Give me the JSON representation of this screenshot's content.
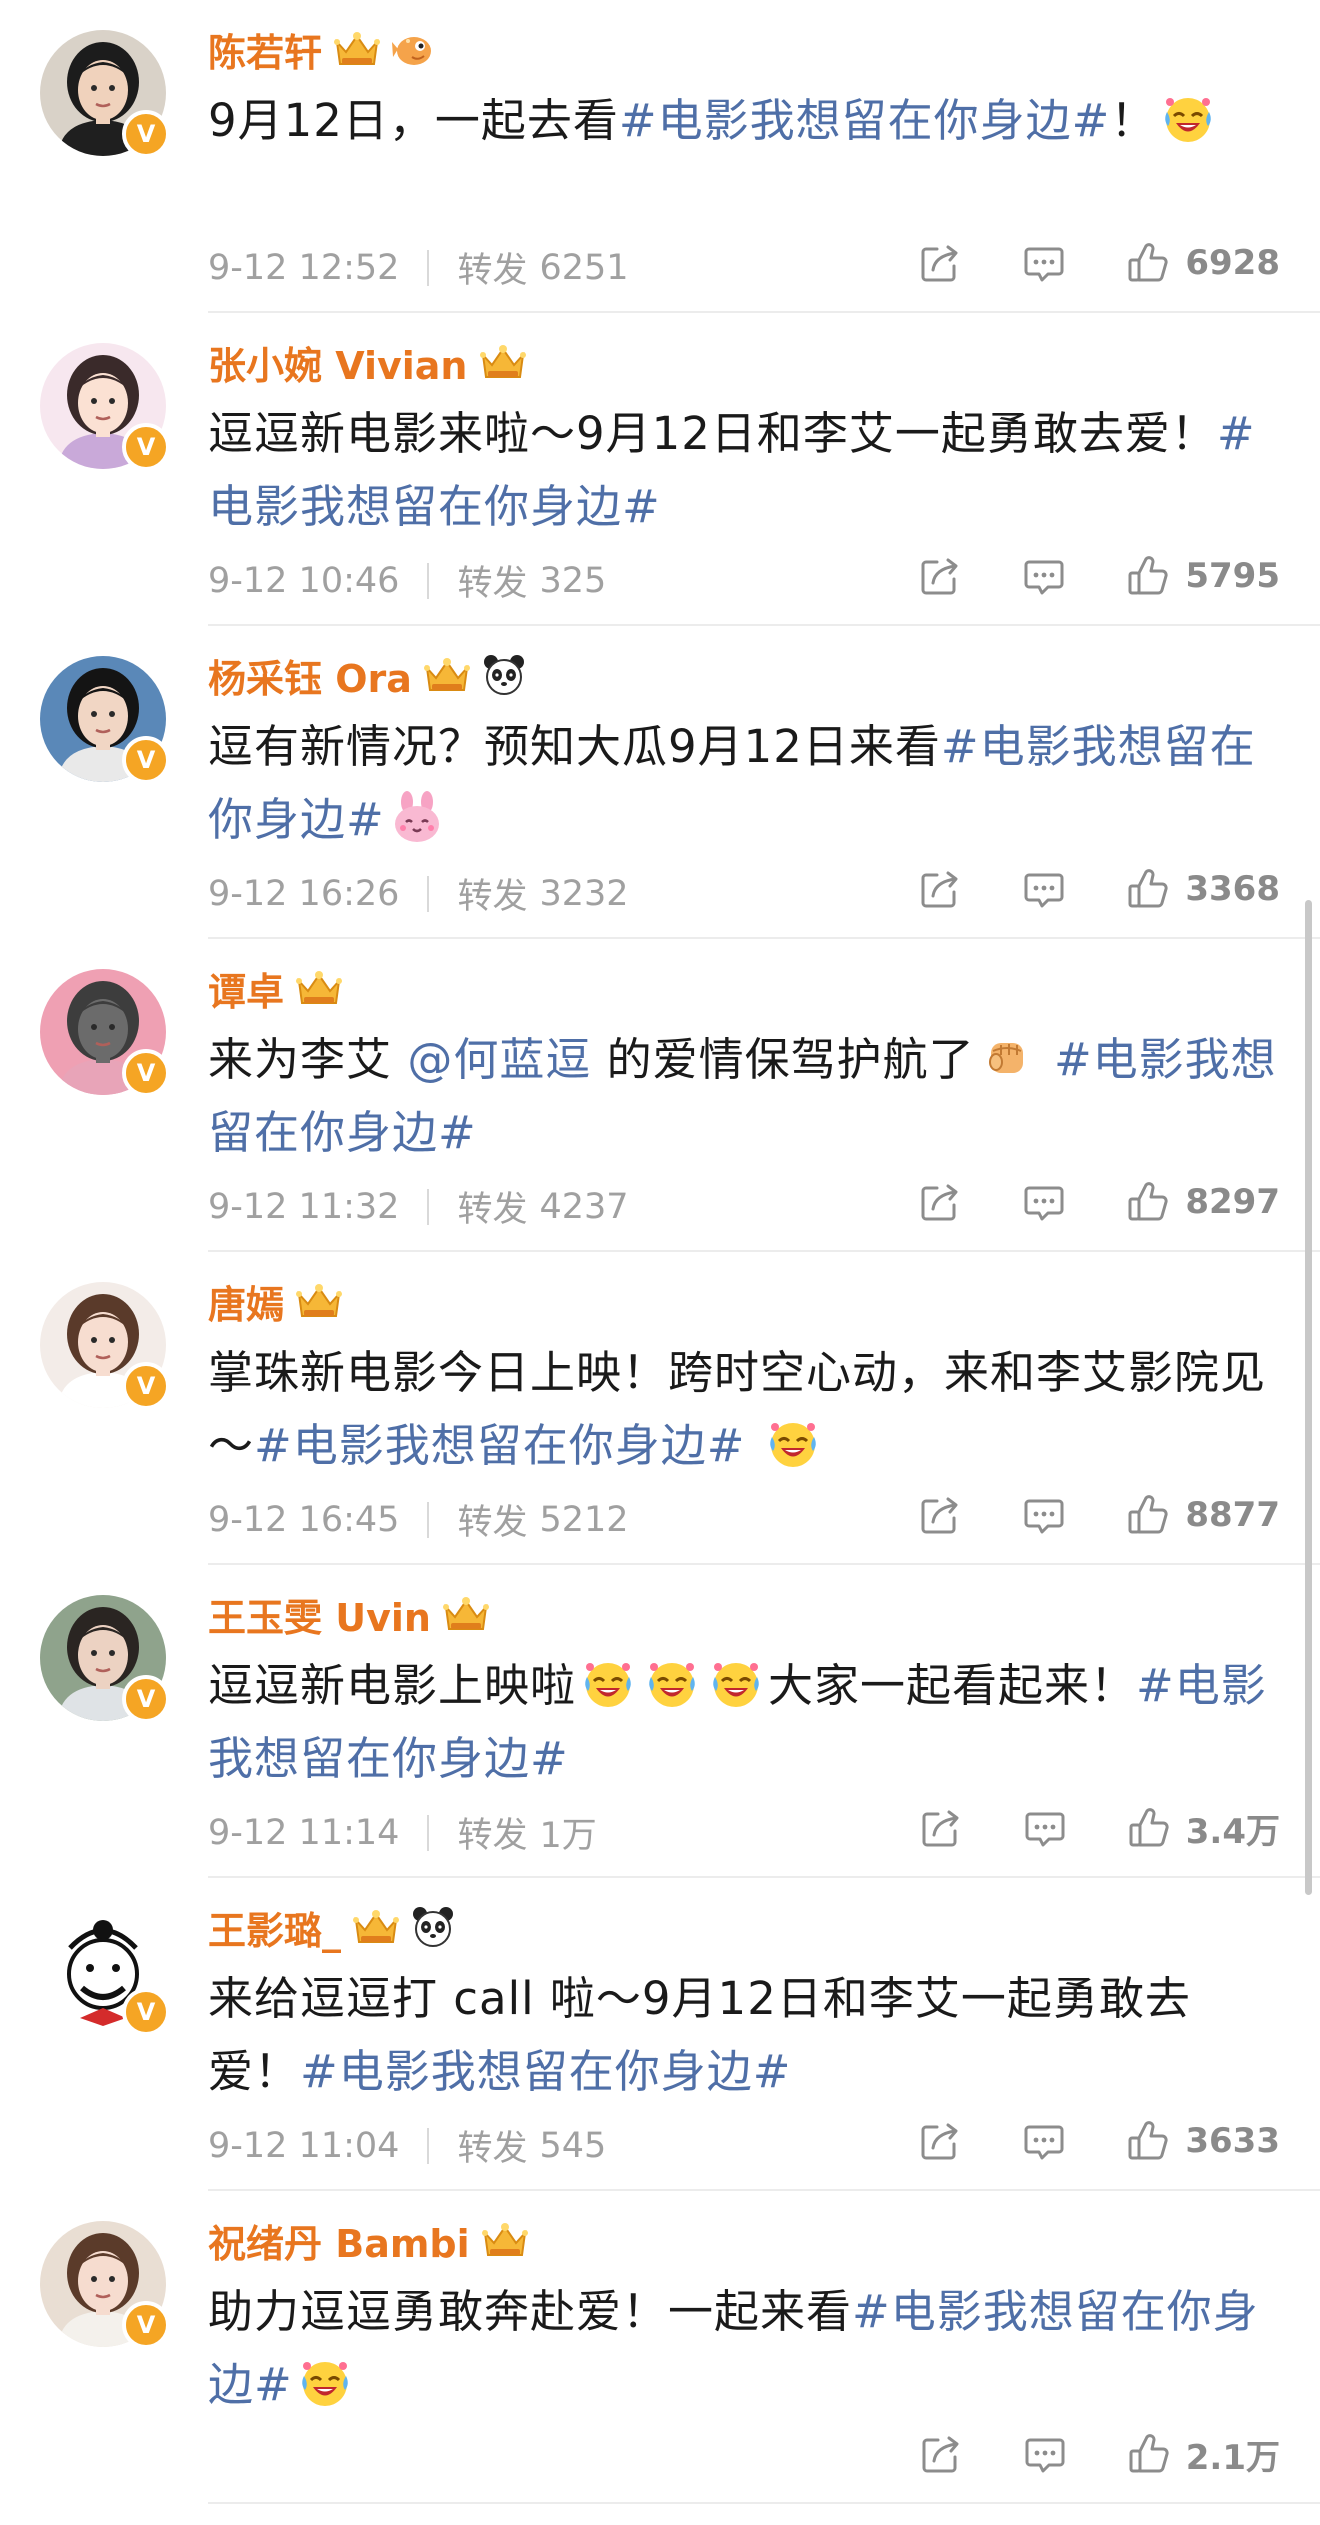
{
  "labels": {
    "repost": "转发"
  },
  "posts": [
    {
      "name": "陈若轩",
      "badges": [
        "crown-icon",
        "pufferfish-icon"
      ],
      "parts": [
        {
          "t": "text",
          "v": "9月12日，一起去看"
        },
        {
          "t": "tag",
          "v": "#电影我想留在你身边#"
        },
        {
          "t": "text",
          "v": "！"
        },
        {
          "t": "emoji",
          "name": "laugh-cry-emoji-icon"
        }
      ],
      "time": "9-12 12:52",
      "reposts": "6251",
      "likes": "6928",
      "avatar": {
        "bg": "#d9d2c8",
        "skin": "#f0d2bc",
        "hair": "#1c1c1c",
        "cloth": "#1f1f1f"
      }
    },
    {
      "name": "张小婉 Vivian",
      "badges": [
        "crown-icon"
      ],
      "parts": [
        {
          "t": "text",
          "v": "逗逗新电影来啦～9月12日和李艾一起勇敢去爱！"
        },
        {
          "t": "tag",
          "v": "#电影我想留在你身边#"
        }
      ],
      "time": "9-12 10:46",
      "reposts": "325",
      "likes": "5795",
      "avatar": {
        "bg": "#f7e7ef",
        "skin": "#fbe1d3",
        "hair": "#3a2a2a",
        "cloth": "#c9a9d9"
      }
    },
    {
      "name": "杨采钰 Ora",
      "badges": [
        "crown-icon",
        "panda-icon"
      ],
      "parts": [
        {
          "t": "text",
          "v": "逗有新情况？预知大瓜9月12日来看"
        },
        {
          "t": "tag",
          "v": "#电影我想留在你身边#"
        },
        {
          "t": "emoji",
          "name": "pink-bunny-emoji-icon"
        }
      ],
      "time": "9-12 16:26",
      "reposts": "3232",
      "likes": "3368",
      "avatar": {
        "bg": "#5a88b8",
        "skin": "#f1d6c4",
        "hair": "#141414",
        "cloth": "#e9e9e9"
      }
    },
    {
      "name": "谭卓",
      "badges": [
        "crown-icon"
      ],
      "parts": [
        {
          "t": "text",
          "v": "来为李艾 "
        },
        {
          "t": "mention",
          "v": "@何蓝逗"
        },
        {
          "t": "text",
          "v": " 的爱情保驾护航了"
        },
        {
          "t": "emoji",
          "name": "fist-emoji-icon"
        },
        {
          "t": "text",
          "v": " "
        },
        {
          "t": "tag",
          "v": "#电影我想留在你身边#"
        }
      ],
      "time": "9-12 11:32",
      "reposts": "4237",
      "likes": "8297",
      "avatar": {
        "bg": "#efa0b3",
        "skin": "#6b6b6b",
        "hair": "#3d3d3d",
        "cloth": "#e8a4b8"
      }
    },
    {
      "name": "唐嫣",
      "badges": [
        "crown-icon"
      ],
      "parts": [
        {
          "t": "text",
          "v": "掌珠新电影今日上映！跨时空心动，来和李艾影院见～"
        },
        {
          "t": "tag",
          "v": "#电影我想留在你身边#"
        },
        {
          "t": "text",
          "v": " "
        },
        {
          "t": "emoji",
          "name": "laugh-cry-emoji-icon"
        }
      ],
      "time": "9-12 16:45",
      "reposts": "5212",
      "likes": "8877",
      "avatar": {
        "bg": "#f3ece8",
        "skin": "#f7ddd0",
        "hair": "#5a3a2a",
        "cloth": "#ffffff"
      }
    },
    {
      "name": "王玉雯 Uvin",
      "badges": [
        "crown-icon"
      ],
      "parts": [
        {
          "t": "text",
          "v": "逗逗新电影上映啦"
        },
        {
          "t": "emoji",
          "name": "laugh-cry-emoji-icon"
        },
        {
          "t": "emoji",
          "name": "laugh-cry-emoji-icon"
        },
        {
          "t": "emoji",
          "name": "laugh-cry-emoji-icon"
        },
        {
          "t": "text",
          "v": "大家一起看起来！"
        },
        {
          "t": "tag",
          "v": "#电影我想留在你身边#"
        }
      ],
      "time": "9-12 11:14",
      "reposts": "1万",
      "likes": "3.4万",
      "avatar": {
        "bg": "#8fa38c",
        "skin": "#ecd2c2",
        "hair": "#2a2522",
        "cloth": "#dfe3e6"
      }
    },
    {
      "name": "王影璐_",
      "badges": [
        "crown-icon",
        "panda-icon"
      ],
      "parts": [
        {
          "t": "text",
          "v": "来给逗逗打 call 啦～9月12日和李艾一起勇敢去爱！"
        },
        {
          "t": "tag",
          "v": "#电影我想留在你身边#"
        }
      ],
      "time": "9-12 11:04",
      "reposts": "545",
      "likes": "3633",
      "avatar": {
        "bg": "#ffffff",
        "skin": "#ffffff",
        "hair": "#111111",
        "cloth": "#d42b2b",
        "drawn": true
      }
    },
    {
      "name": "祝绪丹 Bambi",
      "badges": [
        "crown-icon"
      ],
      "parts": [
        {
          "t": "text",
          "v": "助力逗逗勇敢奔赴爱！一起来看"
        },
        {
          "t": "tag",
          "v": "#电影我想留在你身边#"
        },
        {
          "t": "emoji",
          "name": "laugh-cry-emoji-icon"
        }
      ],
      "time": "",
      "reposts": "",
      "likes": "2.1万",
      "avatar": {
        "bg": "#e9ded3",
        "skin": "#f6dccf",
        "hair": "#5b3b2a",
        "cloth": "#f4f1ec"
      }
    }
  ],
  "colors": {
    "name": "#e8761f",
    "hashtag": "#4f6fa7",
    "meta": "#a0a0a0",
    "verified": "#f5a524"
  }
}
